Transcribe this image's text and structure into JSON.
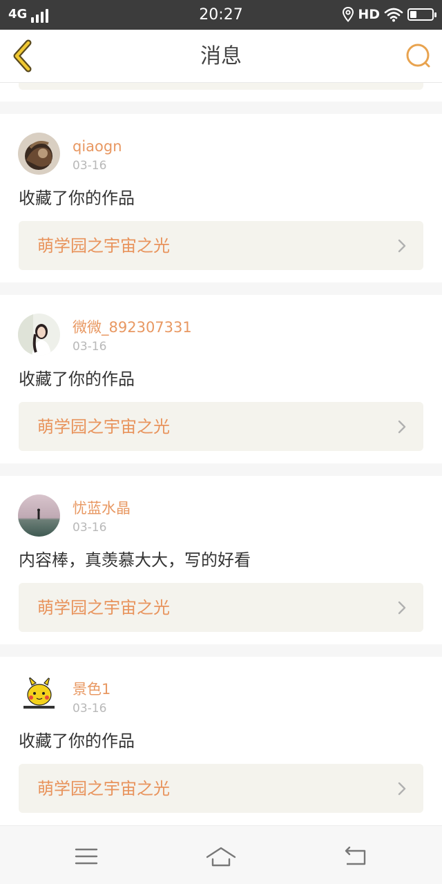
{
  "status_bar": {
    "network": "4G",
    "time": "20:27",
    "hd": "HD"
  },
  "nav": {
    "title": "消息",
    "back_icon": "chevron-left-icon",
    "search_icon": "search-icon",
    "accent_color": "#e8a34f"
  },
  "messages": [
    {
      "username": "qiaogn",
      "date": "03-16",
      "text": "收藏了你的作品",
      "work_title": "萌学园之宇宙之光"
    },
    {
      "username": "微微_892307331",
      "date": "03-16",
      "text": "收藏了你的作品",
      "work_title": "萌学园之宇宙之光"
    },
    {
      "username": "忧蓝水晶",
      "date": "03-16",
      "text": "内容棒，真羡慕大大，写的好看",
      "work_title": "萌学园之宇宙之光"
    },
    {
      "username": "景色1",
      "date": "03-16",
      "text": "收藏了你的作品",
      "work_title": "萌学园之宇宙之光"
    }
  ],
  "colors": {
    "username": "#e89862",
    "work_title": "#e8935c",
    "work_bg": "#f4f3ed",
    "date": "#b8b8b8"
  },
  "system_nav": {
    "icons": [
      "menu-icon",
      "home-icon",
      "back-icon"
    ]
  }
}
